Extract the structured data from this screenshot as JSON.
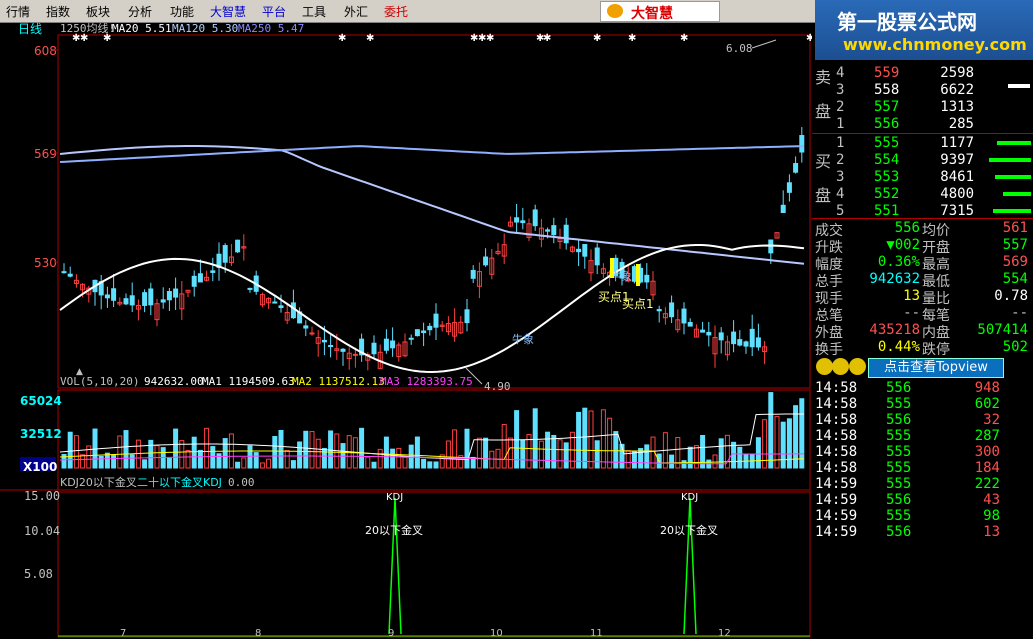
{
  "menu": [
    {
      "label": "行情",
      "color": "black"
    },
    {
      "label": "指数",
      "color": "black"
    },
    {
      "label": "板块",
      "color": "black"
    },
    {
      "label": "分析",
      "color": "black"
    },
    {
      "label": "功能",
      "color": "black"
    },
    {
      "label": "大智慧",
      "color": "blue"
    },
    {
      "label": "平台",
      "color": "blue"
    },
    {
      "label": "工具",
      "color": "black"
    },
    {
      "label": "外汇",
      "color": "black"
    },
    {
      "label": "委托",
      "color": "red"
    }
  ],
  "logo": "大智慧",
  "banner": {
    "title": "第一股票公式网",
    "url": "www.chnmoney.com"
  },
  "chart_header": {
    "period": "日线",
    "ma_prefix": "1250均线!",
    "ma20": "MA20  5.51",
    "ma120": "MA120  5.30",
    "ma250": "MA250  5.47"
  },
  "price_axis": [
    "608",
    "569",
    "530"
  ],
  "price_annotations": {
    "high": "6.08",
    "low": "4.90"
  },
  "signals": {
    "buy1": "买点1",
    "buy2": "买点1",
    "bull1": "牛象",
    "bull2": "牛象"
  },
  "vol_header": {
    "label": "VOL(5,10,20)",
    "vol": "942632.00",
    "ma1": "MA1  1194509.63",
    "ma2": "MA2  1137512.13",
    "ma3": "MA3  1283393.75"
  },
  "vol_axis": [
    "65024",
    "32512",
    "X100"
  ],
  "kdj_header": {
    "label": "KDJ20以下金叉",
    "desc": "二十以下金叉KDJ",
    "val": "0.00"
  },
  "kdj_axis": [
    "15.00",
    "10.04",
    "5.08"
  ],
  "kdj_labels": {
    "kdj": "KDJ",
    "cross": "20以下金叉"
  },
  "date_axis": [
    "7",
    "8",
    "9",
    "10",
    "11",
    "12"
  ],
  "quote": {
    "sell_label": [
      "卖",
      "盘"
    ],
    "buy_label": [
      "买",
      "盘"
    ],
    "sell": [
      {
        "n": "4",
        "price": "559",
        "vol": "2598",
        "color": "#ff5050"
      },
      {
        "n": "3",
        "price": "558",
        "vol": "6622",
        "color": "#ffffff"
      },
      {
        "n": "2",
        "price": "557",
        "vol": "1313",
        "color": "#00ff00"
      },
      {
        "n": "1",
        "price": "556",
        "vol": "285",
        "color": "#00ff00"
      }
    ],
    "buy": [
      {
        "n": "1",
        "price": "555",
        "vol": "1177",
        "color": "#00ff00"
      },
      {
        "n": "2",
        "price": "554",
        "vol": "9397",
        "color": "#00ff00"
      },
      {
        "n": "3",
        "price": "553",
        "vol": "8461",
        "color": "#00ff00"
      },
      {
        "n": "4",
        "price": "552",
        "vol": "4800",
        "color": "#00ff00"
      },
      {
        "n": "5",
        "price": "551",
        "vol": "7315",
        "color": "#00ff00"
      }
    ],
    "stats": [
      {
        "l1": "成交",
        "v1": "556",
        "c1": "#00ff00",
        "l2": "均价",
        "v2": "561",
        "c2": "#ff5050"
      },
      {
        "l1": "升跌",
        "v1": "▼002",
        "c1": "#00ff00",
        "l2": "开盘",
        "v2": "557",
        "c2": "#00ff00"
      },
      {
        "l1": "幅度",
        "v1": "0.36%",
        "c1": "#00ff00",
        "l2": "最高",
        "v2": "569",
        "c2": "#ff5050"
      },
      {
        "l1": "总手",
        "v1": "942632",
        "c1": "#00ffff",
        "l2": "最低",
        "v2": "554",
        "c2": "#00ff00"
      },
      {
        "l1": "现手",
        "v1": "13",
        "c1": "#ffff00",
        "l2": "量比",
        "v2": "0.78",
        "c2": "#ffffff"
      },
      {
        "l1": "总笔",
        "v1": "--",
        "c1": "#c0c0c0",
        "l2": "每笔",
        "v2": "--",
        "c2": "#c0c0c0"
      },
      {
        "l1": "外盘",
        "v1": "435218",
        "c1": "#ff5050",
        "l2": "内盘",
        "v2": "507414",
        "c2": "#00ff00"
      },
      {
        "l1": "换手",
        "v1": "0.44%",
        "c1": "#ffff00",
        "l2": "跌停",
        "v2": "502",
        "c2": "#00ff00"
      }
    ],
    "topview": "点击查看Topview",
    "ticks": [
      {
        "t": "14:58",
        "p": "556",
        "v": "948",
        "vc": "#ff5050"
      },
      {
        "t": "14:58",
        "p": "555",
        "v": "602",
        "vc": "#00ff00"
      },
      {
        "t": "14:58",
        "p": "556",
        "v": "32",
        "vc": "#ff5050"
      },
      {
        "t": "14:58",
        "p": "555",
        "v": "287",
        "vc": "#00ff00"
      },
      {
        "t": "14:58",
        "p": "555",
        "v": "300",
        "vc": "#ff5050"
      },
      {
        "t": "14:58",
        "p": "555",
        "v": "184",
        "vc": "#ff5050"
      },
      {
        "t": "14:59",
        "p": "555",
        "v": "222",
        "vc": "#00ff00"
      },
      {
        "t": "14:59",
        "p": "556",
        "v": "43",
        "vc": "#ff5050"
      },
      {
        "t": "14:59",
        "p": "555",
        "v": "98",
        "vc": "#00ff00"
      },
      {
        "t": "14:59",
        "p": "556",
        "v": "13",
        "vc": "#ff5050"
      }
    ]
  }
}
